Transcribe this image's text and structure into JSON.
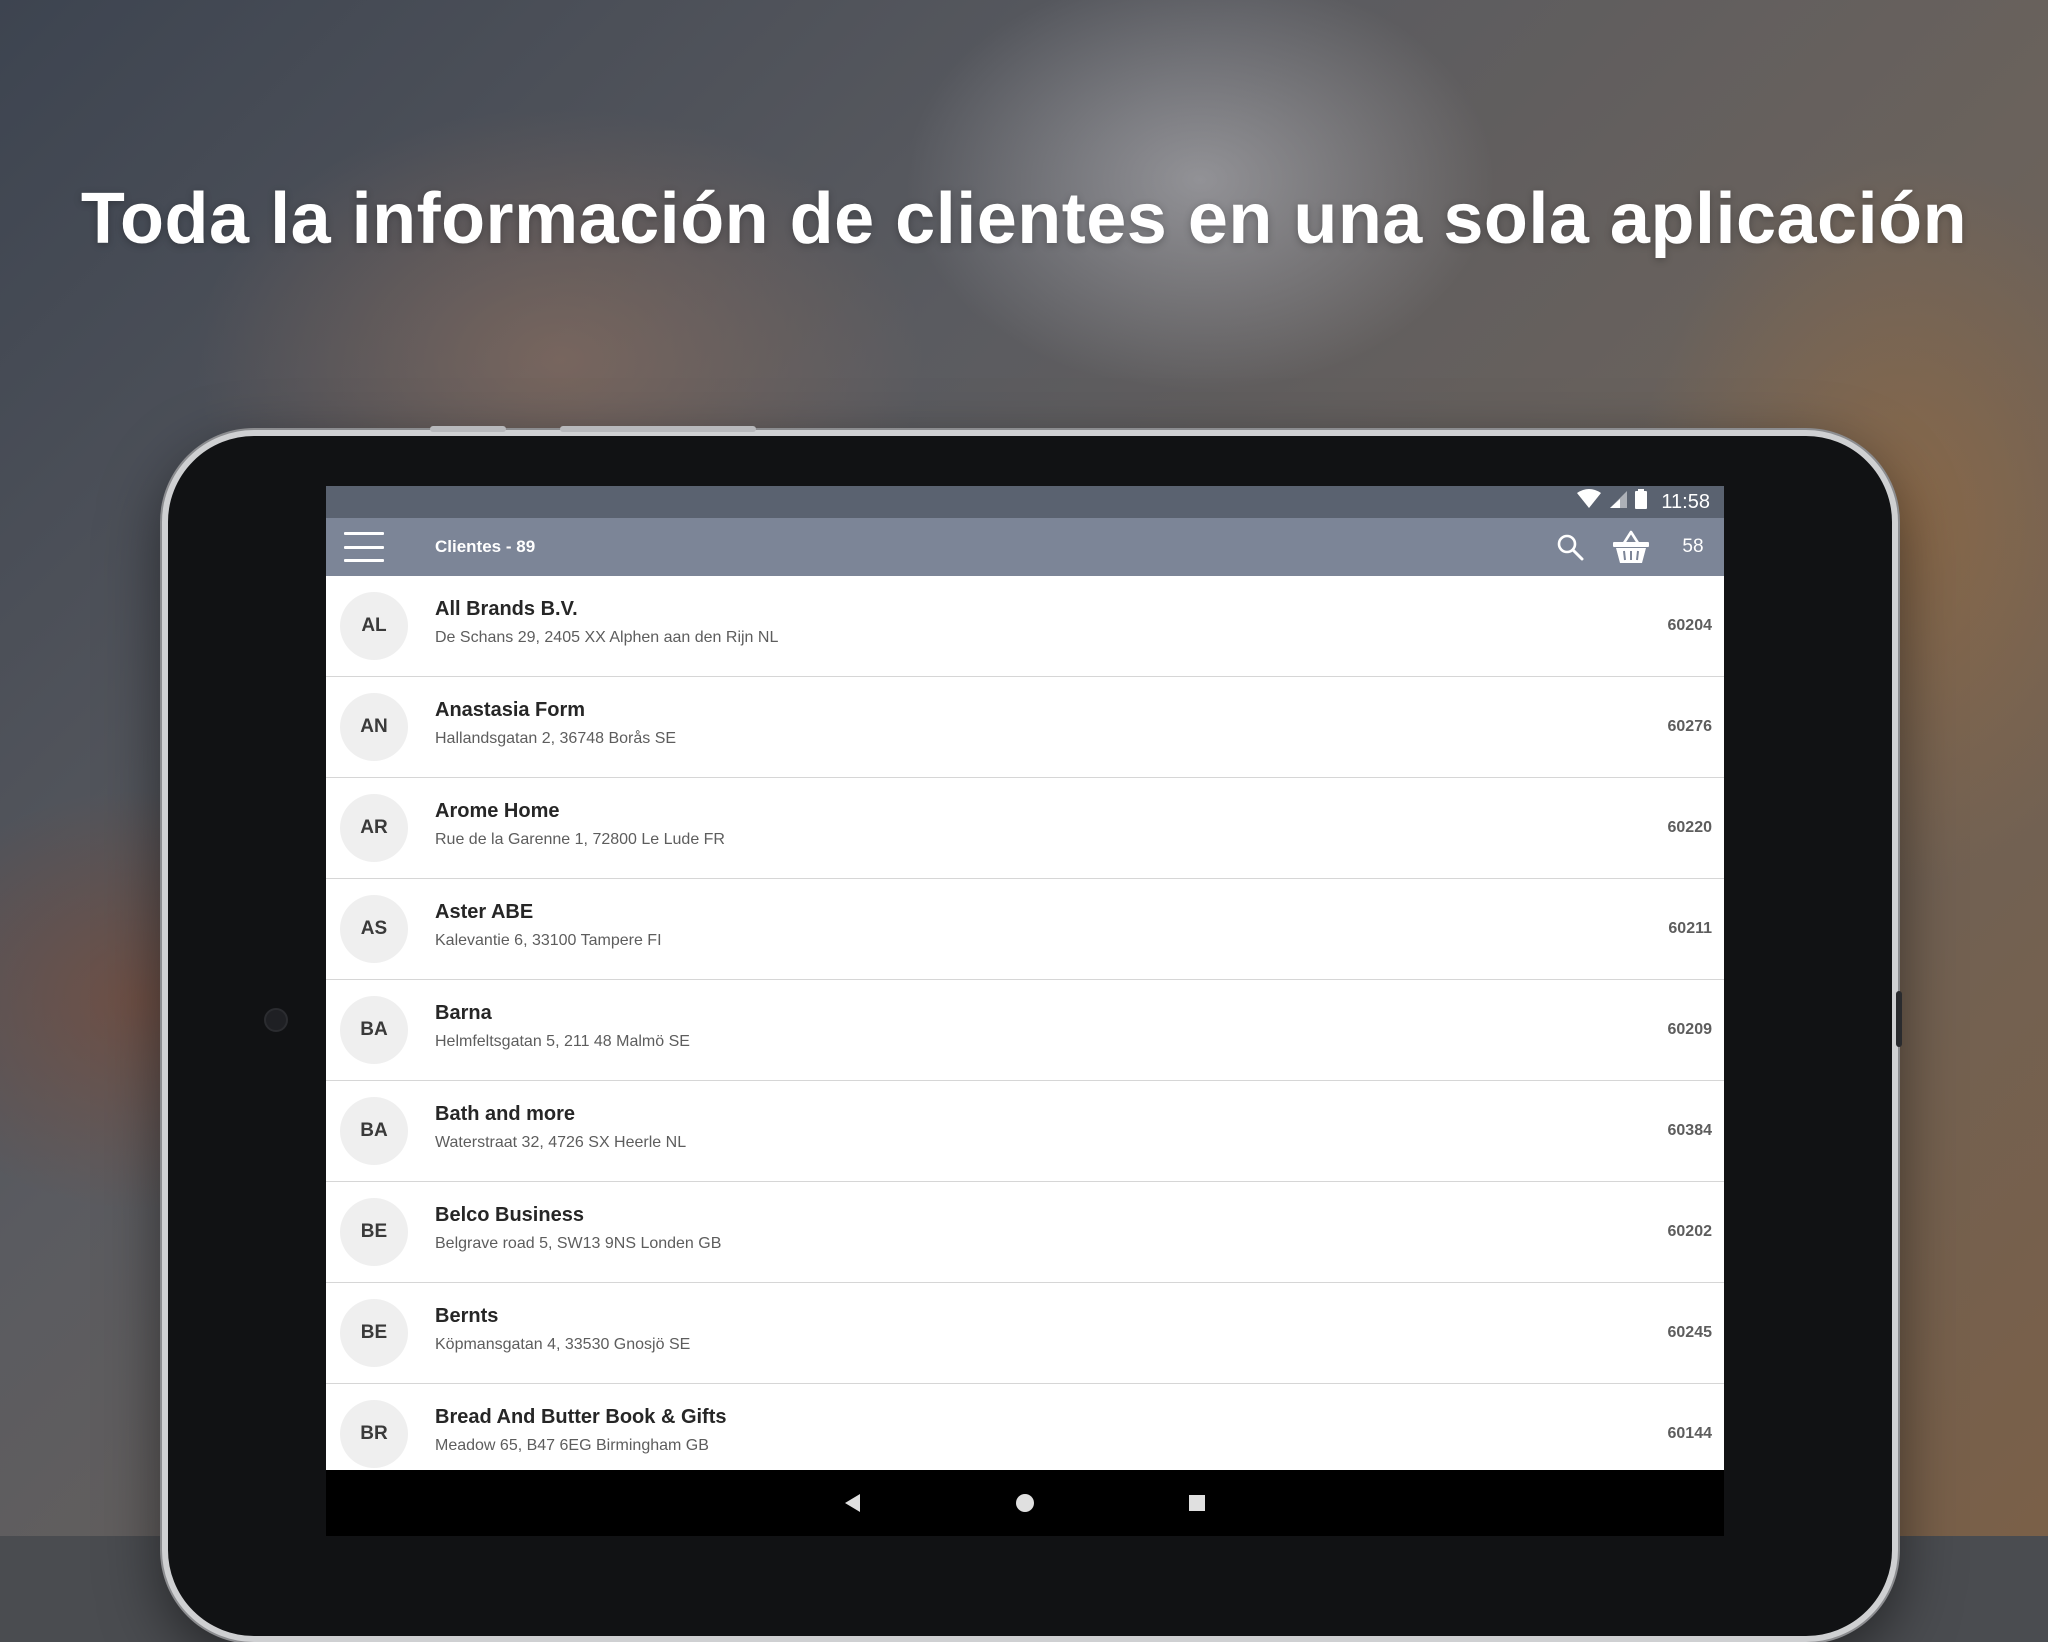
{
  "headline": "Toda la información de clientes en una sola aplicación",
  "status_bar": {
    "time": "11:58",
    "icons": [
      "wifi-icon",
      "signal-icon",
      "battery-icon"
    ]
  },
  "app_bar": {
    "title": "Clientes - 89",
    "menu_icon": "menu-icon",
    "search_icon": "search-icon",
    "cart_icon": "basket-icon",
    "cart_count": "58"
  },
  "customers": [
    {
      "initials": "AL",
      "name": "All Brands B.V.",
      "address": "De Schans 29, 2405 XX Alphen aan den Rijn NL",
      "code": "60204"
    },
    {
      "initials": "AN",
      "name": "Anastasia Form",
      "address": "Hallandsgatan 2, 36748 Borås SE",
      "code": "60276"
    },
    {
      "initials": "AR",
      "name": "Arome Home",
      "address": "Rue de la Garenne 1, 72800 Le Lude FR",
      "code": "60220"
    },
    {
      "initials": "AS",
      "name": "Aster ABE",
      "address": "Kalevantie 6, 33100 Tampere FI",
      "code": "60211"
    },
    {
      "initials": "BA",
      "name": "Barna",
      "address": "Helmfeltsgatan 5, 211 48 Malmö SE",
      "code": "60209"
    },
    {
      "initials": "BA",
      "name": "Bath and more",
      "address": "Waterstraat 32, 4726 SX Heerle NL",
      "code": "60384"
    },
    {
      "initials": "BE",
      "name": "Belco Business",
      "address": "Belgrave road 5, SW13 9NS Londen GB",
      "code": "60202"
    },
    {
      "initials": "BE",
      "name": "Bernts",
      "address": "Köpmansgatan 4, 33530 Gnosjö SE",
      "code": "60245"
    },
    {
      "initials": "BR",
      "name": "Bread And Butter Book & Gifts",
      "address": "Meadow 65, B47 6EG Birmingham GB",
      "code": "60144"
    }
  ],
  "nav_bar": {
    "icons": [
      "back-icon",
      "home-icon",
      "recents-icon"
    ]
  },
  "colors": {
    "status_bar": "#5a6270",
    "app_bar": "#7c8597",
    "avatar_bg": "#efefef",
    "divider": "#d6d6d6"
  }
}
